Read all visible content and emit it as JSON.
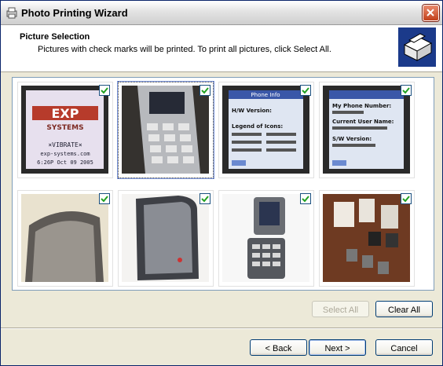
{
  "window": {
    "title": "Photo Printing Wizard"
  },
  "header": {
    "title": "Picture Selection",
    "subtitle": "Pictures with check marks will be printed.  To print all pictures, click Select All."
  },
  "thumbnails": [
    {
      "subject": "phone screen EXP systems",
      "checked": true,
      "caption_lines": [
        "EXP",
        "SYSTEMS",
        "×VIBRATE×",
        "exp-systems.com",
        "6:26P Oct 09 2005"
      ]
    },
    {
      "subject": "phone keypad angle",
      "checked": true
    },
    {
      "subject": "phone info screen",
      "checked": true,
      "caption_lines": [
        "Phone Info",
        "H/W Version:",
        "Legend of Icons:"
      ]
    },
    {
      "subject": "phone number screen",
      "checked": true,
      "caption_lines": [
        "My Phone Number:",
        "Current User Name:",
        "S/W Version:"
      ]
    },
    {
      "subject": "phone closed top",
      "checked": true
    },
    {
      "subject": "phone closed side",
      "checked": true
    },
    {
      "subject": "phone open",
      "checked": true
    },
    {
      "subject": "phone accessories",
      "checked": true
    }
  ],
  "buttons": {
    "select_all": "Select All",
    "clear_all": "Clear All",
    "back": "< Back",
    "next": "Next >",
    "cancel": "Cancel"
  },
  "colors": {
    "accent": "#0a246a",
    "close": "#c2401c",
    "check": "#21a121"
  }
}
